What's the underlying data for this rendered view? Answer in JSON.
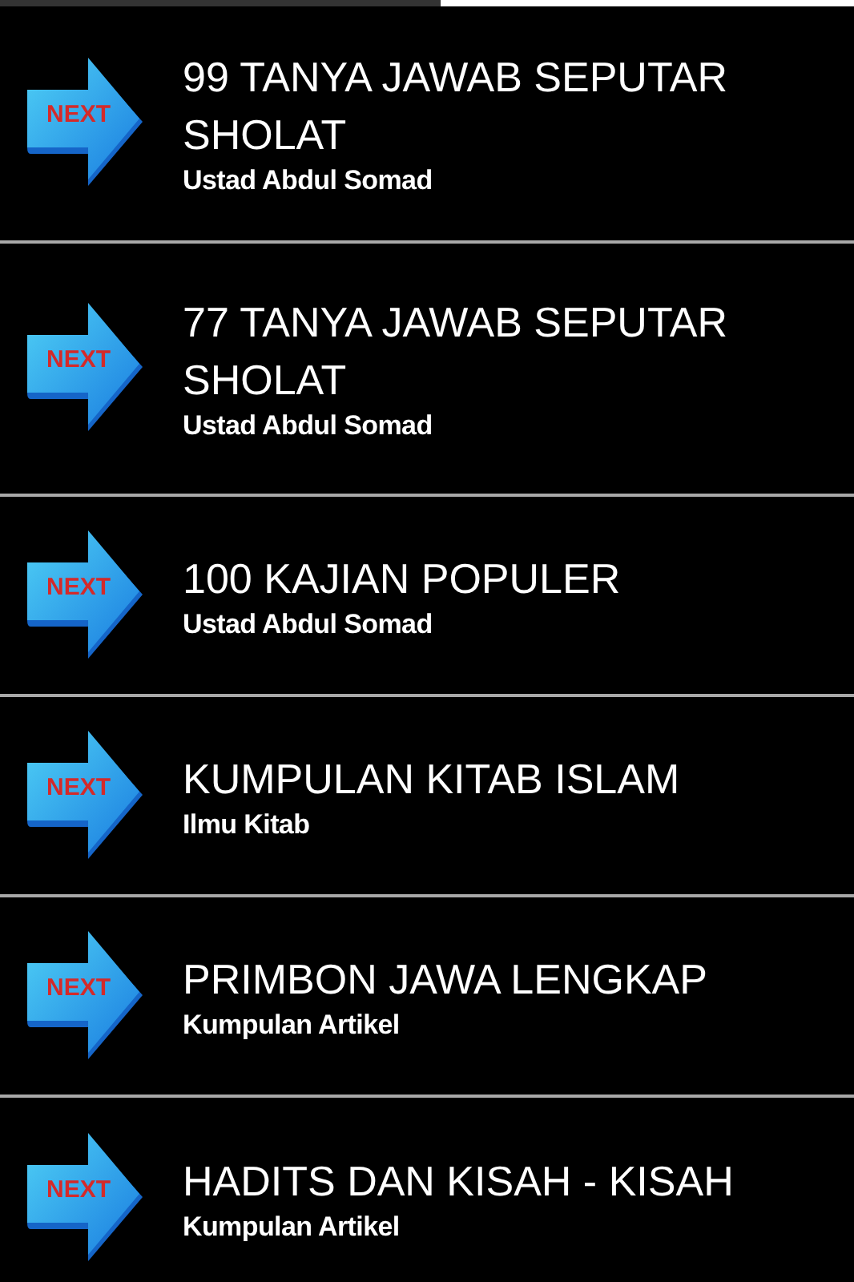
{
  "items": [
    {
      "button_label": "NEXT",
      "title": "99 TANYA JAWAB SEPUTAR SHOLAT",
      "subtitle": "Ustad Abdul Somad"
    },
    {
      "button_label": "NEXT",
      "title": "77 TANYA JAWAB SEPUTAR SHOLAT",
      "subtitle": "Ustad Abdul Somad"
    },
    {
      "button_label": "NEXT",
      "title": "100 KAJIAN POPULER",
      "subtitle": "Ustad Abdul Somad"
    },
    {
      "button_label": "NEXT",
      "title": "KUMPULAN KITAB ISLAM",
      "subtitle": "Ilmu Kitab"
    },
    {
      "button_label": "NEXT",
      "title": "PRIMBON JAWA LENGKAP",
      "subtitle": "Kumpulan Artikel"
    },
    {
      "button_label": "NEXT",
      "title": "HADITS DAN KISAH - KISAH",
      "subtitle": "Kumpulan Artikel"
    }
  ]
}
